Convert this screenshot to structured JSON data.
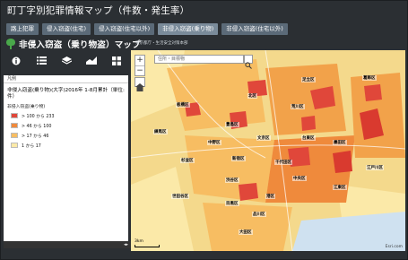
{
  "app": {
    "title": "町丁字別犯罪情報マップ（件数・発生率）"
  },
  "tabs": [
    {
      "label": "路上犯罪"
    },
    {
      "label": "侵入窃盗(住宅)"
    },
    {
      "label": "侵入窃盗(住宅以外)"
    },
    {
      "label": "非侵入窃盗(乗り物)"
    },
    {
      "label": "非侵入窃盗(住宅以外)"
    }
  ],
  "active_tab_index": 3,
  "header": {
    "map_title": "非侵入窃盗（乗り物盗）マップ",
    "source": "東京都庁・生活安全対策本部"
  },
  "toolbar": {
    "icons": [
      "info-icon",
      "list-icon",
      "layers-icon",
      "chart-icon",
      "grid-icon"
    ]
  },
  "legend": {
    "header": "凡例",
    "title": "非侵入窃盗(乗り物)(大字)2016年 1-8月累計（単位:件）",
    "subtitle": "非侵入窃盗(乗り物)",
    "classes": [
      {
        "label": "> 100 から 233",
        "color": "#e0473a"
      },
      {
        "label": "> 46 から 100",
        "color": "#ef8a3c"
      },
      {
        "label": "> 17 から 46",
        "color": "#f7bd62"
      },
      {
        "label": "1 から 17",
        "color": "#fbe9a8"
      }
    ]
  },
  "map": {
    "search_placeholder": "住所・目標物",
    "zoom_in": "+",
    "zoom_out": "−",
    "scale_label": "3km",
    "attribution": "Esri.com",
    "wards": [
      {
        "name": "板橋区"
      },
      {
        "name": "北区"
      },
      {
        "name": "足立区"
      },
      {
        "name": "葛飾区"
      },
      {
        "name": "練馬区"
      },
      {
        "name": "豊島区"
      },
      {
        "name": "荒川区"
      },
      {
        "name": "中野区"
      },
      {
        "name": "文京区"
      },
      {
        "name": "台東区"
      },
      {
        "name": "墨田区"
      },
      {
        "name": "杉並区"
      },
      {
        "name": "新宿区"
      },
      {
        "name": "千代田区"
      },
      {
        "name": "江戸川区"
      },
      {
        "name": "渋谷区"
      },
      {
        "name": "中央区"
      },
      {
        "name": "江東区"
      },
      {
        "name": "世田谷区"
      },
      {
        "name": "港区"
      },
      {
        "name": "目黒区"
      },
      {
        "name": "品川区"
      },
      {
        "name": "大田区"
      }
    ]
  }
}
